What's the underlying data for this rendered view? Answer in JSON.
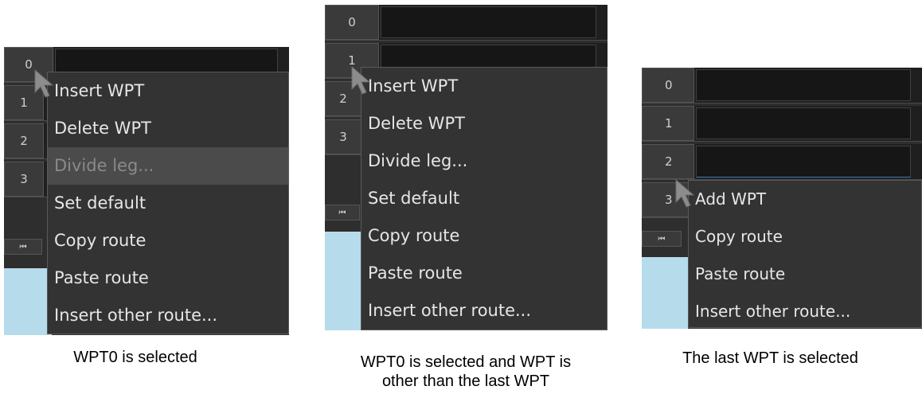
{
  "panels": [
    {
      "rows": [
        "0",
        "1",
        "2",
        "3"
      ],
      "nav_label": "⏮",
      "menu_items": [
        {
          "label": "Insert WPT",
          "enabled": true
        },
        {
          "label": "Delete WPT",
          "enabled": true
        },
        {
          "label": "Divide leg...",
          "enabled": false
        },
        {
          "label": "Set default",
          "enabled": true
        },
        {
          "label": "Copy route",
          "enabled": true
        },
        {
          "label": "Paste route",
          "enabled": true
        },
        {
          "label": "Insert other route...",
          "enabled": true
        }
      ],
      "caption": "WPT0 is selected"
    },
    {
      "rows": [
        "0",
        "1",
        "2",
        "3"
      ],
      "nav_label": "⏮",
      "menu_items": [
        {
          "label": "Insert WPT",
          "enabled": true
        },
        {
          "label": "Delete WPT",
          "enabled": true
        },
        {
          "label": "Divide leg...",
          "enabled": true
        },
        {
          "label": "Set default",
          "enabled": true
        },
        {
          "label": "Copy route",
          "enabled": true
        },
        {
          "label": "Paste route",
          "enabled": true
        },
        {
          "label": "Insert other route...",
          "enabled": true
        }
      ],
      "caption_line1": "WPT0 is selected and WPT is",
      "caption_line2": "other than the last WPT"
    },
    {
      "rows": [
        "0",
        "1",
        "2",
        "3"
      ],
      "nav_label": "⏮",
      "menu_items": [
        {
          "label": "Add WPT",
          "enabled": true
        },
        {
          "label": "Copy route",
          "enabled": true
        },
        {
          "label": "Paste route",
          "enabled": true
        },
        {
          "label": "Insert other route...",
          "enabled": true
        }
      ],
      "caption": "The last WPT is selected"
    }
  ]
}
